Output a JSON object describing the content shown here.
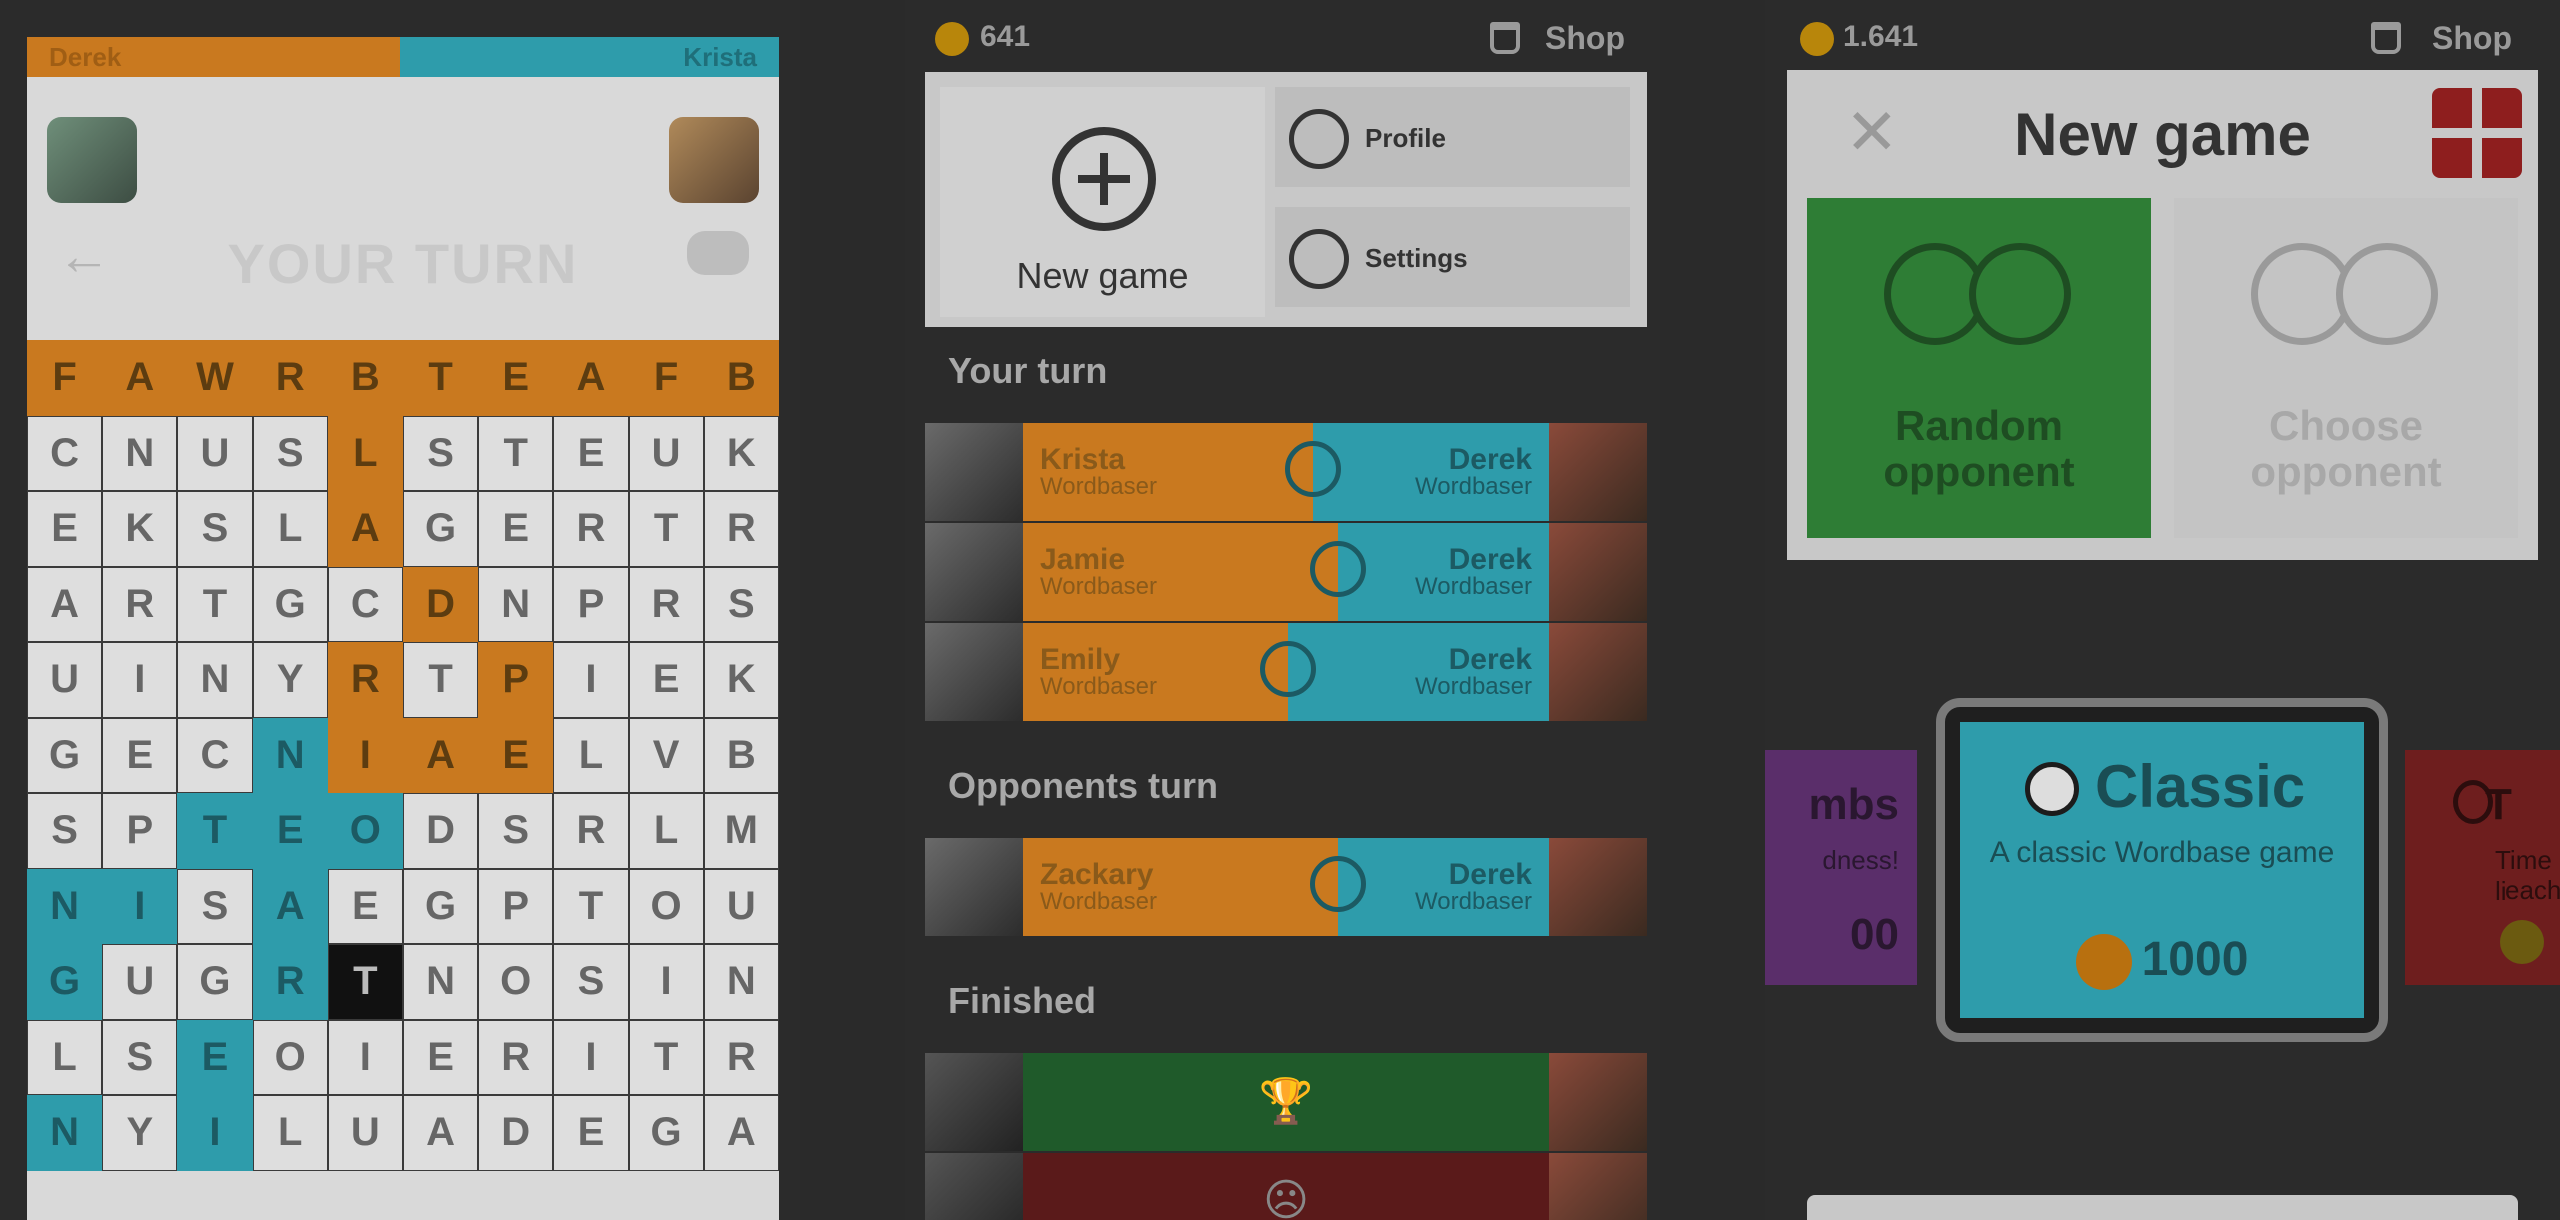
{
  "board": {
    "score_left_name": "Derek",
    "score_right_name": "Krista",
    "turn_label": "YOUR TURN",
    "rows": [
      [
        [
          "F",
          "o"
        ],
        [
          "A",
          "o"
        ],
        [
          "W",
          "o"
        ],
        [
          "R",
          "o"
        ],
        [
          "B",
          "o"
        ],
        [
          "T",
          "o"
        ],
        [
          "E",
          "o"
        ],
        [
          "A",
          "o"
        ],
        [
          "F",
          "o"
        ],
        [
          "B",
          "o"
        ]
      ],
      [
        [
          "C",
          ""
        ],
        [
          "N",
          ""
        ],
        [
          "U",
          ""
        ],
        [
          "S",
          ""
        ],
        [
          "L",
          "o"
        ],
        [
          "S",
          ""
        ],
        [
          "T",
          ""
        ],
        [
          "E",
          ""
        ],
        [
          "U",
          ""
        ],
        [
          "K",
          ""
        ]
      ],
      [
        [
          "E",
          ""
        ],
        [
          "K",
          ""
        ],
        [
          "S",
          ""
        ],
        [
          "L",
          ""
        ],
        [
          "A",
          "o"
        ],
        [
          "G",
          ""
        ],
        [
          "E",
          ""
        ],
        [
          "R",
          ""
        ],
        [
          "T",
          ""
        ],
        [
          "R",
          ""
        ]
      ],
      [
        [
          "A",
          ""
        ],
        [
          "R",
          ""
        ],
        [
          "T",
          ""
        ],
        [
          "G",
          ""
        ],
        [
          "C",
          ""
        ],
        [
          "D",
          "o"
        ],
        [
          "N",
          ""
        ],
        [
          "P",
          ""
        ],
        [
          "R",
          ""
        ],
        [
          "S",
          ""
        ]
      ],
      [
        [
          "U",
          ""
        ],
        [
          "I",
          ""
        ],
        [
          "N",
          ""
        ],
        [
          "Y",
          ""
        ],
        [
          "R",
          "o"
        ],
        [
          "T",
          ""
        ],
        [
          "P",
          "o"
        ],
        [
          "I",
          ""
        ],
        [
          "E",
          ""
        ],
        [
          "K",
          ""
        ]
      ],
      [
        [
          "G",
          ""
        ],
        [
          "E",
          ""
        ],
        [
          "C",
          ""
        ],
        [
          "N",
          "t"
        ],
        [
          "I",
          "o"
        ],
        [
          "A",
          "o"
        ],
        [
          "E",
          "o"
        ],
        [
          "L",
          ""
        ],
        [
          "V",
          ""
        ],
        [
          "B",
          ""
        ]
      ],
      [
        [
          "S",
          ""
        ],
        [
          "P",
          ""
        ],
        [
          "T",
          "t"
        ],
        [
          "E",
          "t"
        ],
        [
          "O",
          "t"
        ],
        [
          "D",
          ""
        ],
        [
          "S",
          ""
        ],
        [
          "R",
          ""
        ],
        [
          "L",
          ""
        ],
        [
          "M",
          ""
        ]
      ],
      [
        [
          "N",
          "t"
        ],
        [
          "I",
          "t"
        ],
        [
          "S",
          ""
        ],
        [
          "A",
          "t"
        ],
        [
          "E",
          ""
        ],
        [
          "G",
          ""
        ],
        [
          "P",
          ""
        ],
        [
          "T",
          ""
        ],
        [
          "O",
          ""
        ],
        [
          "U",
          ""
        ]
      ],
      [
        [
          "G",
          "t"
        ],
        [
          "U",
          ""
        ],
        [
          "G",
          ""
        ],
        [
          "R",
          "t"
        ],
        [
          "T",
          "d"
        ],
        [
          "N",
          ""
        ],
        [
          "O",
          ""
        ],
        [
          "S",
          ""
        ],
        [
          "I",
          ""
        ],
        [
          "N",
          ""
        ]
      ],
      [
        [
          "L",
          ""
        ],
        [
          "S",
          ""
        ],
        [
          "E",
          "t"
        ],
        [
          "O",
          ""
        ],
        [
          "I",
          ""
        ],
        [
          "E",
          ""
        ],
        [
          "R",
          ""
        ],
        [
          "I",
          ""
        ],
        [
          "T",
          ""
        ],
        [
          "R",
          ""
        ]
      ],
      [
        [
          "N",
          "t"
        ],
        [
          "Y",
          ""
        ],
        [
          "I",
          "t"
        ],
        [
          "L",
          ""
        ],
        [
          "U",
          ""
        ],
        [
          "A",
          ""
        ],
        [
          "D",
          ""
        ],
        [
          "E",
          ""
        ],
        [
          "G",
          ""
        ],
        [
          "A",
          ""
        ]
      ]
    ]
  },
  "lobby": {
    "coins": "641",
    "shop_label": "Shop",
    "new_game_label": "New game",
    "profile_label": "Profile",
    "settings_label": "Settings",
    "section_your_turn": "Your turn",
    "section_opponents_turn": "Opponents turn",
    "section_finished": "Finished",
    "your_turn_games": [
      {
        "opponent": "Krista",
        "opponent_sub": "Wordbaser",
        "player": "Derek",
        "player_sub": "Wordbaser",
        "mode_icon": "stopwatch-icon"
      },
      {
        "opponent": "Jamie",
        "opponent_sub": "Wordbaser",
        "player": "Derek",
        "player_sub": "Wordbaser",
        "mode_icon": "ball-icon"
      },
      {
        "opponent": "Emily",
        "opponent_sub": "Wordbaser",
        "player": "Derek",
        "player_sub": "Wordbaser",
        "mode_icon": "coin-gear-icon"
      }
    ],
    "opponents_turn_games": [
      {
        "opponent": "Zackary",
        "opponent_sub": "Wordbaser",
        "player": "Derek",
        "player_sub": "Wordbaser",
        "mode_icon": "bomb-icon"
      }
    ],
    "finished_games": [
      {
        "result_icon": "trophy-icon",
        "symbol": "🏆",
        "color": "#1f5a2a"
      },
      {
        "result_icon": "sad-face-icon",
        "symbol": "☹",
        "color": "#5a1a1a"
      }
    ]
  },
  "newgame": {
    "coins": "1.641",
    "shop_label": "Shop",
    "title": "New game",
    "close_symbol": "✕",
    "random_label": "Random opponent",
    "choose_label": "Choose opponent",
    "modes": {
      "left_title": "mbs",
      "left_desc": "dness!",
      "left_price": "00",
      "classic_title": "Classic",
      "classic_desc": "A classic Wordbase game",
      "classic_price": "1000",
      "right_title": "T",
      "right_desc1": "Time li",
      "right_desc2": "each"
    }
  },
  "colors": {
    "orange": "#c9791f",
    "teal": "#2e9cab",
    "green": "#2e7d35",
    "overlay": "#2b2b2b"
  }
}
